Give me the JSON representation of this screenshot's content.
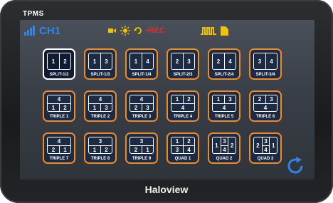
{
  "device": {
    "label": "TPMS",
    "brand": "Haloview"
  },
  "status": {
    "channel": "CH1",
    "rec": "REC",
    "icon_names": [
      "signal-icon",
      "camera-icon",
      "sun-icon",
      "rotate-icon",
      "wave-icon",
      "file-icon"
    ],
    "colors": {
      "blue": "#2f86e8",
      "yellow": "#f2c400",
      "red": "#e32b2b",
      "accent": "#f08b24"
    }
  },
  "tiles": [
    {
      "label": "SPLIT-1/2",
      "layout": "2h",
      "cells": [
        "1",
        "2"
      ],
      "selected": true
    },
    {
      "label": "SPLIT-1/3",
      "layout": "2h",
      "cells": [
        "1",
        "3"
      ]
    },
    {
      "label": "SPLIT-1/4",
      "layout": "2h",
      "cells": [
        "1",
        "4"
      ]
    },
    {
      "label": "SPLIT-2/3",
      "layout": "2h",
      "cells": [
        "2",
        "3"
      ]
    },
    {
      "label": "SPLIT-2/4",
      "layout": "2h",
      "cells": [
        "2",
        "4"
      ]
    },
    {
      "label": "SPLIT-3/4",
      "layout": "2h",
      "cells": [
        "3",
        "4"
      ]
    },
    {
      "label": "TRIPLE 1",
      "layout": "top1-bot2",
      "cells": [
        "4",
        "1",
        "2"
      ]
    },
    {
      "label": "TRIPLE 2",
      "layout": "top1-bot2",
      "cells": [
        "4",
        "1",
        "3"
      ]
    },
    {
      "label": "TRIPLE 3",
      "layout": "top1-bot2",
      "cells": [
        "4",
        "2",
        "3"
      ]
    },
    {
      "label": "TRIPLE 4",
      "layout": "top2-bot1",
      "cells": [
        "1",
        "2",
        "4"
      ]
    },
    {
      "label": "TRIPLE 5",
      "layout": "top2-bot1",
      "cells": [
        "1",
        "3",
        "4"
      ]
    },
    {
      "label": "TRIPLE 6",
      "layout": "top2-bot1",
      "cells": [
        "2",
        "3",
        "4"
      ]
    },
    {
      "label": "TRIPLE 7",
      "layout": "top1-bot2",
      "cells": [
        "4",
        "2",
        "1"
      ]
    },
    {
      "label": "TRIPLE 8",
      "layout": "top1-bot2",
      "cells": [
        "3",
        "1",
        "2"
      ]
    },
    {
      "label": "TRIPLE 9",
      "layout": "top1-bot2",
      "cells": [
        "3",
        "2",
        "1"
      ]
    },
    {
      "label": "QUAD 1",
      "layout": "quad",
      "cells": [
        "1",
        "2",
        "3",
        "4"
      ]
    },
    {
      "label": "QUAD 2",
      "layout": "quad-side",
      "cells": [
        "1",
        "3",
        "4",
        "2"
      ]
    },
    {
      "label": "QUAD 3",
      "layout": "quad-side",
      "cells": [
        "2",
        "3",
        "4",
        "1"
      ]
    }
  ]
}
